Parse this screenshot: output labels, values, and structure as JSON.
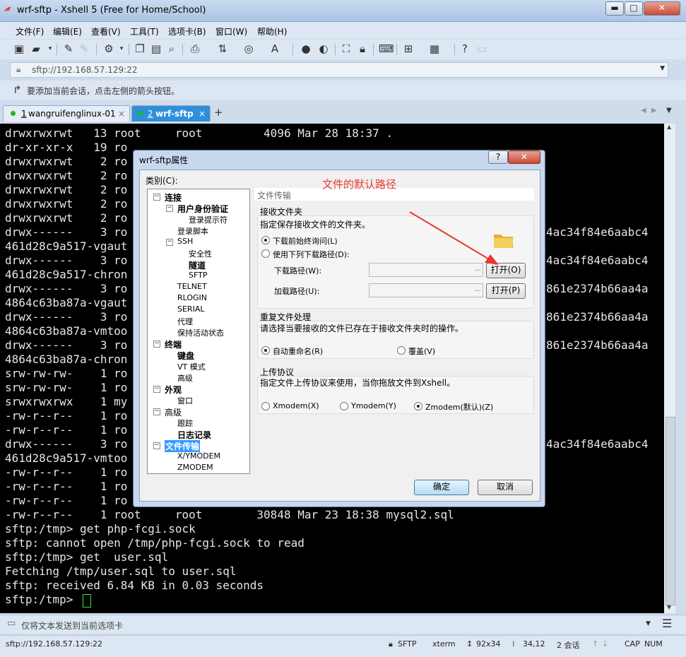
{
  "window": {
    "title": "wrf-sftp - Xshell 5 (Free for Home/School)",
    "minimize": "▬",
    "maximize": "□",
    "close": "✕"
  },
  "menu": [
    "文件(F)",
    "编辑(E)",
    "查看(V)",
    "工具(T)",
    "选项卡(B)",
    "窗口(W)",
    "帮助(H)"
  ],
  "address": {
    "value": "sftp://192.168.57.129:22"
  },
  "hint": "要添加当前会话，点击左侧的箭头按钮。",
  "tabs": [
    {
      "number": "1",
      "label": "wangruifenglinux-01",
      "active": false
    },
    {
      "number": "2",
      "label": "wrf-sftp",
      "active": true
    }
  ],
  "terminal": {
    "lines": [
      "drwxrwxrwt   13 root     root         4096 Mar 28 18:37 .",
      "dr-xr-xr-x   19 ro",
      "drwxrwxrwt    2 ro",
      "drwxrwxrwt    2 ro",
      "drwxrwxrwt    2 ro",
      "drwxrwxrwt    2 ro",
      "drwxrwxrwt    2 ro",
      "drwx------    3 ro",
      "461d28c9a517-vgaut",
      "drwx------    3 ro",
      "461d28c9a517-chron",
      "drwx------    3 ro",
      "4864c63ba87a-vgaut",
      "drwx------    3 ro",
      "4864c63ba87a-vmtoo",
      "drwx------    3 ro",
      "4864c63ba87a-chron",
      "srw-rw-rw-    1 ro",
      "srw-rw-rw-    1 ro",
      "srwxrwxrwx    1 my",
      "-rw-r--r--    1 ro",
      "-rw-r--r--    1 ro",
      "drwx------    3 ro",
      "461d28c9a517-vmtoo",
      "-rw-r--r--    1 ro",
      "-rw-r--r--    1 ro",
      "-rw-r--r--    1 ro",
      "-rw-r--r--    1 root     root        30848 Mar 23 18:38 mysql2.sql",
      "sftp:/tmp> get php-fcgi.sock",
      "sftp: cannot open /tmp/php-fcgi.sock to read",
      "sftp:/tmp> get  user.sql",
      "Fetching /tmp/user.sql to user.sql",
      "sftp: received 6.84 KB in 0.03 seconds",
      "sftp:/tmp> "
    ],
    "right_fragments": [
      {
        "line": 7,
        "text": "4ac34f84e6aabc4"
      },
      {
        "line": 9,
        "text": "4ac34f84e6aabc4"
      },
      {
        "line": 11,
        "text": "861e2374b66aa4a"
      },
      {
        "line": 13,
        "text": "861e2374b66aa4a"
      },
      {
        "line": 15,
        "text": "861e2374b66aa4a"
      },
      {
        "line": 22,
        "text": "4ac34f84e6aabc4"
      }
    ]
  },
  "send_bar": "仅将文本发送到当前选项卡",
  "status": {
    "address": "sftp://192.168.57.129:22",
    "protocol": "SFTP",
    "term": "xterm",
    "size": "92x34",
    "cursor": "34,12",
    "sessions": "2 会话",
    "caps": "CAP",
    "num": "NUM"
  },
  "dialog": {
    "title": "wrf-sftp属性",
    "help": "?",
    "close": "✕",
    "category_label": "类别(C):",
    "tree": [
      {
        "label": "连接",
        "level": 0,
        "bold": true,
        "expander": "−"
      },
      {
        "label": "用户身份验证",
        "level": 1,
        "bold": true,
        "expander": "−"
      },
      {
        "label": "登录提示符",
        "level": 2,
        "bold": false
      },
      {
        "label": "登录脚本",
        "level": 1,
        "bold": false
      },
      {
        "label": "SSH",
        "level": 1,
        "bold": false,
        "expander": "−"
      },
      {
        "label": "安全性",
        "level": 2,
        "bold": false
      },
      {
        "label": "隧道",
        "level": 2,
        "bold": true
      },
      {
        "label": "SFTP",
        "level": 2,
        "bold": false
      },
      {
        "label": "TELNET",
        "level": 1,
        "bold": false
      },
      {
        "label": "RLOGIN",
        "level": 1,
        "bold": false
      },
      {
        "label": "SERIAL",
        "level": 1,
        "bold": false
      },
      {
        "label": "代理",
        "level": 1,
        "bold": false
      },
      {
        "label": "保持活动状态",
        "level": 1,
        "bold": false
      },
      {
        "label": "终端",
        "level": 0,
        "bold": true,
        "expander": "−"
      },
      {
        "label": "键盘",
        "level": 1,
        "bold": true
      },
      {
        "label": "VT 模式",
        "level": 1,
        "bold": false
      },
      {
        "label": "高级",
        "level": 1,
        "bold": false
      },
      {
        "label": "外观",
        "level": 0,
        "bold": true,
        "expander": "−"
      },
      {
        "label": "窗口",
        "level": 1,
        "bold": false
      },
      {
        "label": "高级",
        "level": 0,
        "bold": false,
        "expander": "−"
      },
      {
        "label": "跟踪",
        "level": 1,
        "bold": false
      },
      {
        "label": "日志记录",
        "level": 1,
        "bold": true
      },
      {
        "label": "文件传输",
        "level": 0,
        "bold": true,
        "expander": "−",
        "selected": true
      },
      {
        "label": "X/YMODEM",
        "level": 1,
        "bold": false
      },
      {
        "label": "ZMODEM",
        "level": 1,
        "bold": false
      }
    ],
    "section_title": "文件传输",
    "annotation": "文件的默认路径",
    "receive": {
      "title": "接收文件夹",
      "desc": "指定保存接收文件的文件夹。",
      "opt_ask": "下载前始终询问(L)",
      "opt_path": "使用下列下载路径(D):",
      "download_label": "下载路径(W):",
      "upload_label": "加载路径(U):",
      "browse": "...",
      "open_o": "打开(O)",
      "open_p": "打开(P)"
    },
    "duplicate": {
      "title": "重复文件处理",
      "desc": "请选择当要接收的文件已存在于接收文件夹时的操作。",
      "opt_rename": "自动重命名(R)",
      "opt_overwrite": "覆盖(V)"
    },
    "upload": {
      "title": "上传协议",
      "desc": "指定文件上传协议来使用，当你拖放文件到Xshell。",
      "xmodem": "Xmodem(X)",
      "ymodem": "Ymodem(Y)",
      "zmodem": "Zmodem(默认)(Z)"
    },
    "ok": "确定",
    "cancel": "取消"
  },
  "colors": {
    "accent": "#2f8fd8",
    "annotation": "#e53b2c",
    "terminal_bg": "#000000",
    "cursor": "#2ee82e"
  }
}
